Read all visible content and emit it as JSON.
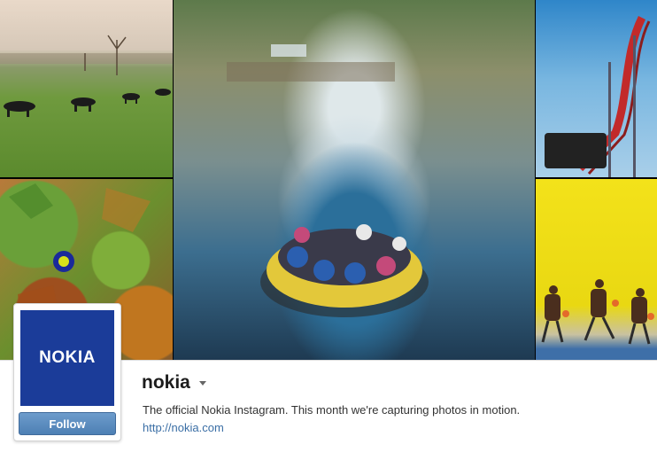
{
  "profile": {
    "logo_text": "NOKIA",
    "username": "nokia",
    "follow_label": "Follow",
    "bio": "The official Nokia Instagram. This month we're capturing photos in motion.",
    "website": "http://nokia.com"
  },
  "photos": [
    {
      "id": "photo-dogs-field"
    },
    {
      "id": "photo-autumn-leaves"
    },
    {
      "id": "photo-river-raft"
    },
    {
      "id": "photo-roller-coaster"
    },
    {
      "id": "photo-basketball"
    }
  ],
  "colors": {
    "logo_bg": "#1b3c99",
    "follow_button": "#4d7fb4",
    "link": "#3a6ea5"
  }
}
